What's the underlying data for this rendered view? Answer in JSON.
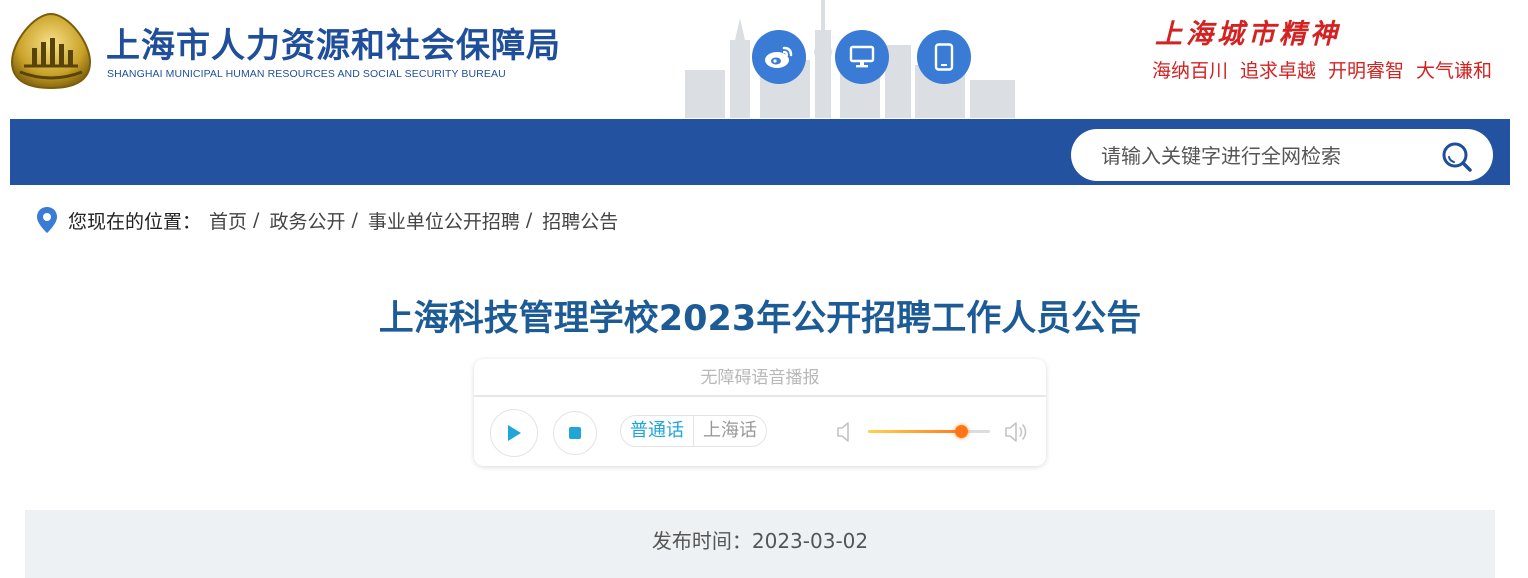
{
  "header": {
    "org_name_cn": "上海市人力资源和社会保障局",
    "org_name_en": "SHANGHAI MUNICIPAL HUMAN RESOURCES AND SOCIAL SECURITY BUREAU",
    "icons": [
      "weibo-icon",
      "desktop-icon",
      "mobile-icon"
    ],
    "spirit_title": "上海城市精神",
    "spirit_words": [
      "海纳百川",
      "追求卓越",
      "开明睿智",
      "大气谦和"
    ]
  },
  "nav": {
    "search_placeholder": "请输入关键字进行全网检索"
  },
  "breadcrumb": {
    "lead": "您现在的位置：",
    "items": [
      "首页",
      "政务公开",
      "事业单位公开招聘",
      "招聘公告"
    ],
    "separator": "/"
  },
  "article": {
    "title": "上海科技管理学校2023年公开招聘工作人员公告",
    "publish_label": "发布时间：2023-03-02"
  },
  "player": {
    "heading": "无障碍语音播报",
    "languages": [
      "普通话",
      "上海话"
    ],
    "selected_language": "普通话",
    "volume": 0.76
  },
  "colors": {
    "brand_blue": "#1f4e9a",
    "nav_blue": "#2353a0",
    "title_blue": "#1c5b96",
    "spirit_red": "#d42222",
    "accent_cyan": "#1fa6d9",
    "volume_orange": "#ff7414"
  }
}
